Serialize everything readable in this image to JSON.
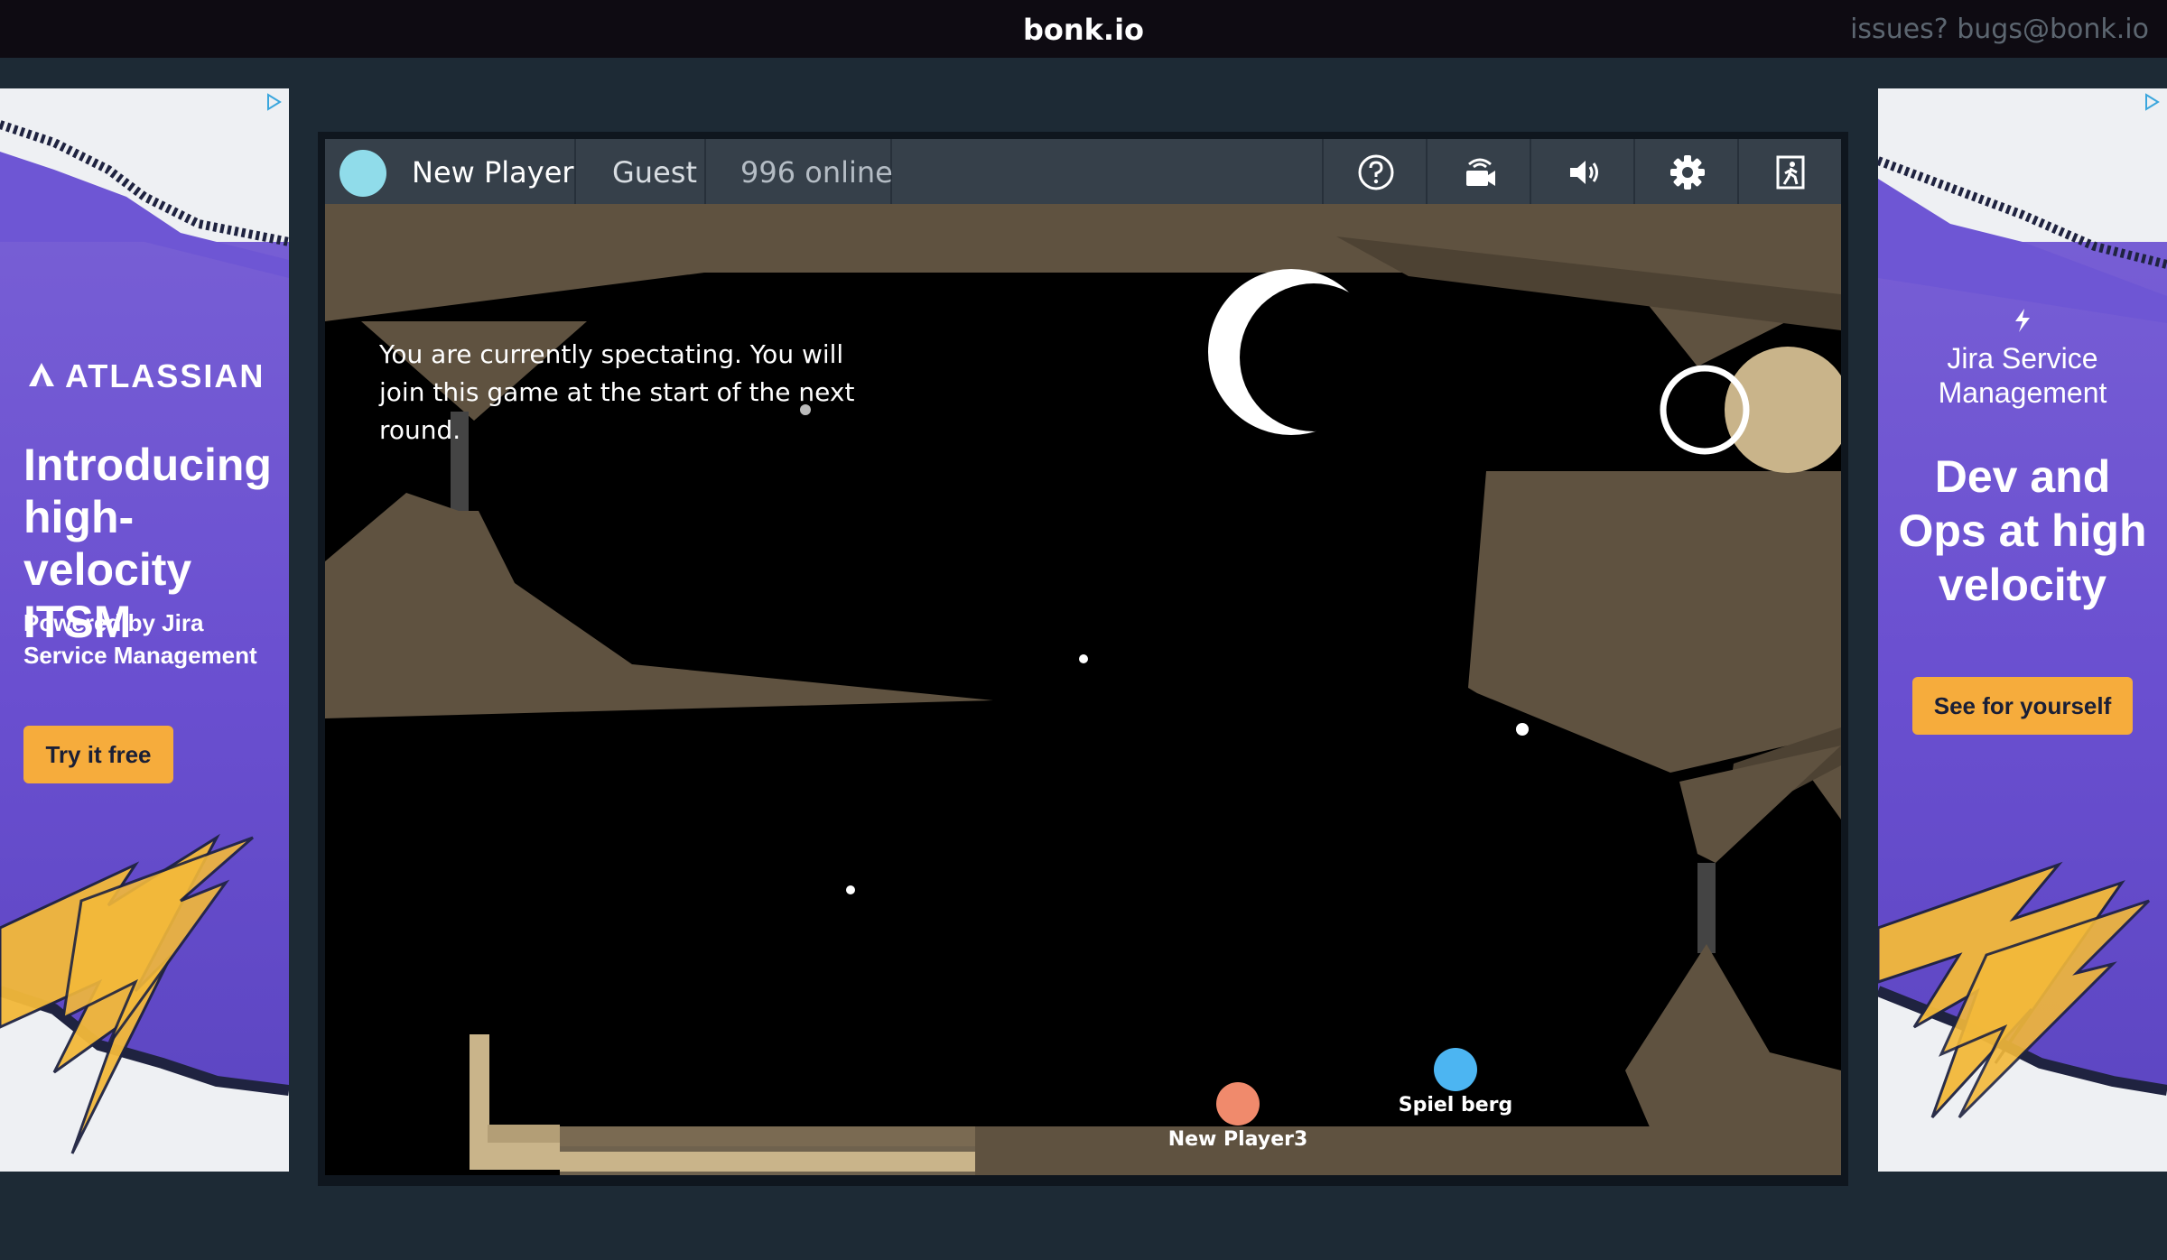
{
  "site": {
    "title": "bonk.io",
    "issues": "issues? bugs@bonk.io"
  },
  "header": {
    "player_name": "New Player",
    "account_type": "Guest",
    "online": "996 online",
    "avatar_color": "#90dcea",
    "buttons": [
      "help-icon",
      "spectate-camera-icon",
      "volume-icon",
      "settings-icon",
      "exit-icon"
    ]
  },
  "game": {
    "spectate_message": "You are currently spectating. You will join this game at the start of the next round.",
    "players": [
      {
        "name": "New Player3",
        "color": "#f08a6c"
      },
      {
        "name": "Spiel berg",
        "color": "#4cb5f2"
      }
    ],
    "ground_color": "#5f5240",
    "platform_color": "#c9b48a"
  },
  "ads": {
    "left": {
      "brand": "ATLASSIAN",
      "headline": "Introducing high-velocity ITSM",
      "sub": "Powered by Jira Service Management",
      "cta": "Try it free"
    },
    "right": {
      "brand": "Jira Service Management",
      "headline": "Dev and Ops at high velocity",
      "cta": "See for yourself"
    }
  }
}
